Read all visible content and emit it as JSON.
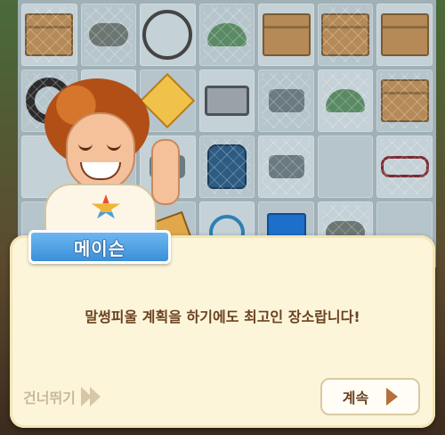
{
  "dialog": {
    "speaker": "메이슨",
    "message": "말썽피울 계획을 하기에도 최고인 장소랍니다!",
    "skip_label": "건너뛰기",
    "continue_label": "계속"
  },
  "icons": {
    "skip": "double-chevron-right-icon",
    "continue": "play-triangle-icon"
  },
  "colors": {
    "name_tag": "#3b8fd8",
    "dialog_bg": "#fdf5da",
    "text": "#6b4220",
    "skip_text": "#c9b89c"
  }
}
